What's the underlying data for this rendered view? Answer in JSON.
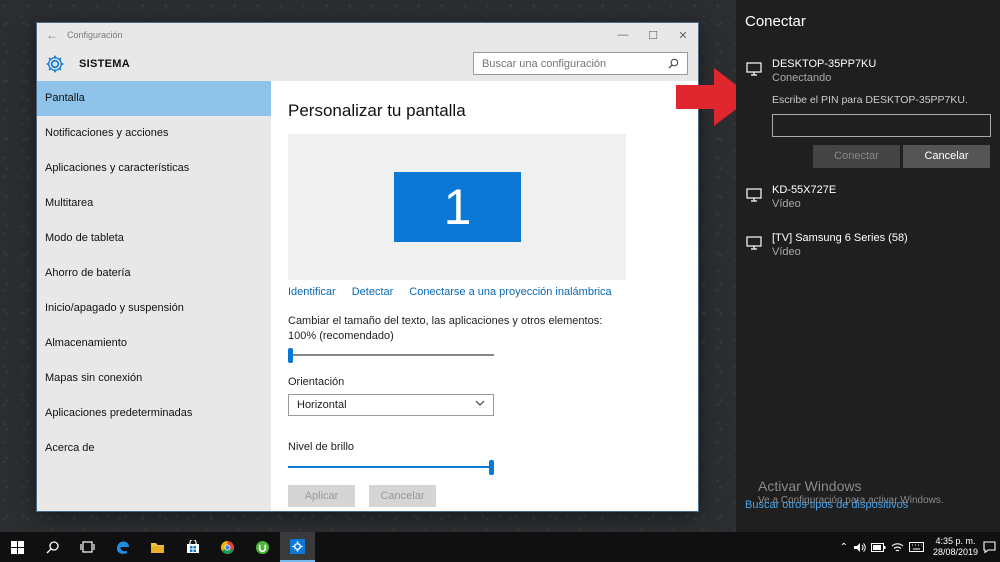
{
  "window": {
    "title": "Configuración",
    "back_glyph": "←",
    "min_glyph": "—",
    "max_glyph": "☐",
    "close_glyph": "✕"
  },
  "header": {
    "section": "SISTEMA",
    "search_placeholder": "Buscar una configuración"
  },
  "sidebar": {
    "items": [
      {
        "label": "Pantalla"
      },
      {
        "label": "Notificaciones y acciones"
      },
      {
        "label": "Aplicaciones y características"
      },
      {
        "label": "Multitarea"
      },
      {
        "label": "Modo de tableta"
      },
      {
        "label": "Ahorro de batería"
      },
      {
        "label": "Inicio/apagado y suspensión"
      },
      {
        "label": "Almacenamiento"
      },
      {
        "label": "Mapas sin conexión"
      },
      {
        "label": "Aplicaciones predeterminadas"
      },
      {
        "label": "Acerca de"
      }
    ]
  },
  "main": {
    "title": "Personalizar tu pantalla",
    "monitor_number": "1",
    "links": {
      "identify": "Identificar",
      "detect": "Detectar",
      "wireless": "Conectarse a una proyección inalámbrica"
    },
    "scale_label": "Cambiar el tamaño del texto, las aplicaciones y otros elementos: 100% (recomendado)",
    "scale_fraction": 0.0,
    "orientation_label": "Orientación",
    "orientation_value": "Horizontal",
    "brightness_label": "Nivel de brillo",
    "brightness_fraction": 1.0,
    "apply": "Aplicar",
    "cancel": "Cancelar"
  },
  "connect": {
    "title": "Conectar",
    "devices": [
      {
        "name": "DESKTOP-35PP7KU",
        "status": "Conectando"
      },
      {
        "name": "KD-55X727E",
        "status": "Vídeo"
      },
      {
        "name": "[TV] Samsung 6 Series (58)",
        "status": "Vídeo"
      }
    ],
    "pin_prompt": "Escribe el PIN para DESKTOP-35PP7KU.",
    "pin_value": "",
    "connect_button": "Conectar",
    "cancel_button": "Cancelar",
    "more_link": "Buscar otros tipos de dispositivos"
  },
  "watermark": {
    "title": "Activar Windows",
    "subtitle": "Ve a Configuración para activar Windows."
  },
  "taskbar": {
    "time": "4:35 p. m.",
    "date": "28/08/2019",
    "accent": "#76b9ed"
  },
  "colors": {
    "accent": "#0a78d4",
    "sidebar_active": "#8fc3e9",
    "arrow": "#e0262e"
  }
}
